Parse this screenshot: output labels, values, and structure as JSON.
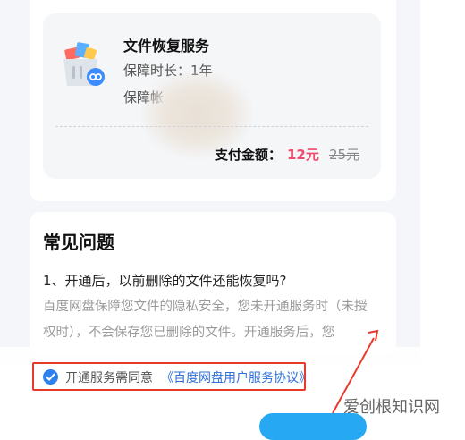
{
  "service": {
    "title": "文件恢复服务",
    "duration": "保障时长：1年",
    "account_prefix": "保障帐"
  },
  "payment": {
    "label": "支付金额：",
    "price": "12元",
    "original_price": "25元"
  },
  "faq": {
    "title": "常见问题",
    "question": "1、开通后，以前删除的文件还能恢复吗?",
    "answer": "百度网盘保障您文件的隐私安全，您未开通服务时（未授权时），不会保存您已删除的文件。开通服务后，您"
  },
  "agreement": {
    "text": "开通服务需同意",
    "link": "《百度网盘用户服务协议》",
    "checked": true
  },
  "watermark": "爱创根知识网",
  "colors": {
    "accent_blue": "#2f80ed",
    "price_red": "#ef4b6f",
    "highlight_red": "#e8392b",
    "button_blue": "#27a8f3"
  }
}
